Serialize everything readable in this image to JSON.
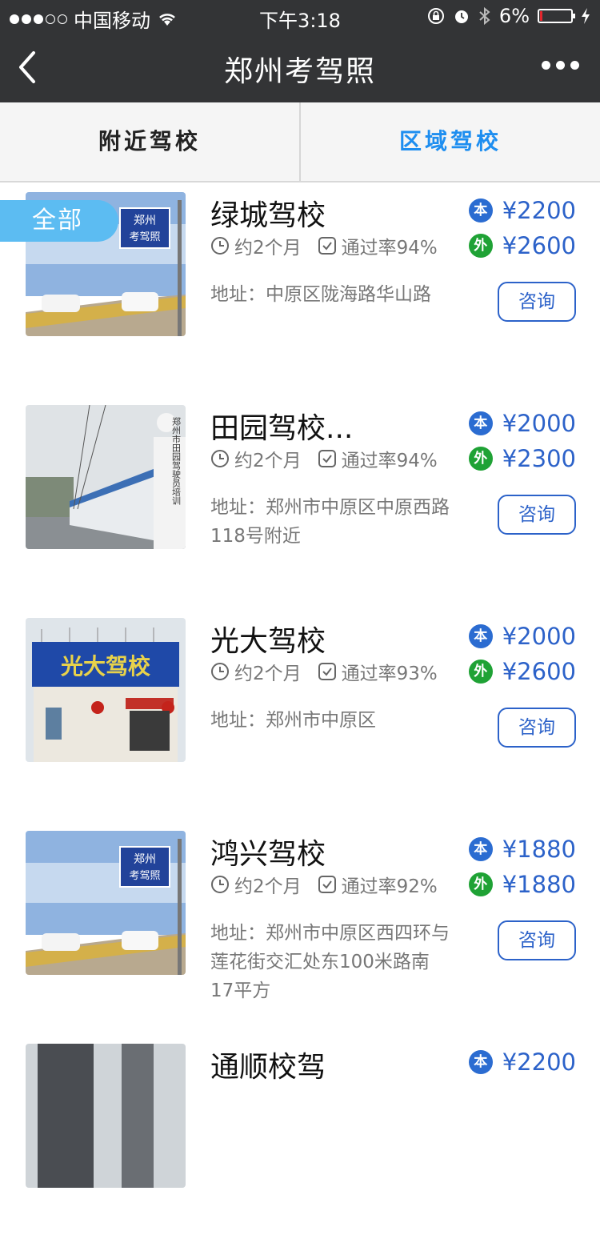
{
  "status_bar": {
    "carrier": "中国移动",
    "time": "下午3:18",
    "battery_percent": "6%",
    "battery_level": 0.06
  },
  "nav": {
    "title": "郑州考驾照"
  },
  "tabs": [
    {
      "label": "附近驾校",
      "active": false
    },
    {
      "label": "区域驾校",
      "active": true
    }
  ],
  "filter_tag": "全部",
  "schools": [
    {
      "name": "绿城驾校",
      "duration": "约2个月",
      "pass_rate": "通过率94%",
      "address": "地址：中原区陇海路华山路",
      "local_label": "本",
      "local_price": "¥2200",
      "out_label": "外",
      "out_price": "¥2600",
      "consult_label": "咨询",
      "image_sign": "郑州\n考驾照"
    },
    {
      "name": "田园驾校...",
      "duration": "约2个月",
      "pass_rate": "通过率94%",
      "address": "地址：郑州市中原区中原西路118号附近",
      "local_label": "本",
      "local_price": "¥2000",
      "out_label": "外",
      "out_price": "¥2300",
      "consult_label": "咨询"
    },
    {
      "name": "光大驾校",
      "duration": "约2个月",
      "pass_rate": "通过率93%",
      "address": "地址：郑州市中原区",
      "local_label": "本",
      "local_price": "¥2000",
      "out_label": "外",
      "out_price": "¥2600",
      "consult_label": "咨询",
      "image_sign": "光大驾校"
    },
    {
      "name": "鸿兴驾校",
      "duration": "约2个月",
      "pass_rate": "通过率92%",
      "address": "地址：郑州市中原区西四环与莲花街交汇处东100米路南17平方",
      "local_label": "本",
      "local_price": "¥1880",
      "out_label": "外",
      "out_price": "¥1880",
      "consult_label": "咨询",
      "image_sign": "郑州\n考驾照"
    },
    {
      "name": "通顺校驾",
      "local_label": "本",
      "local_price": "¥2200"
    }
  ]
}
